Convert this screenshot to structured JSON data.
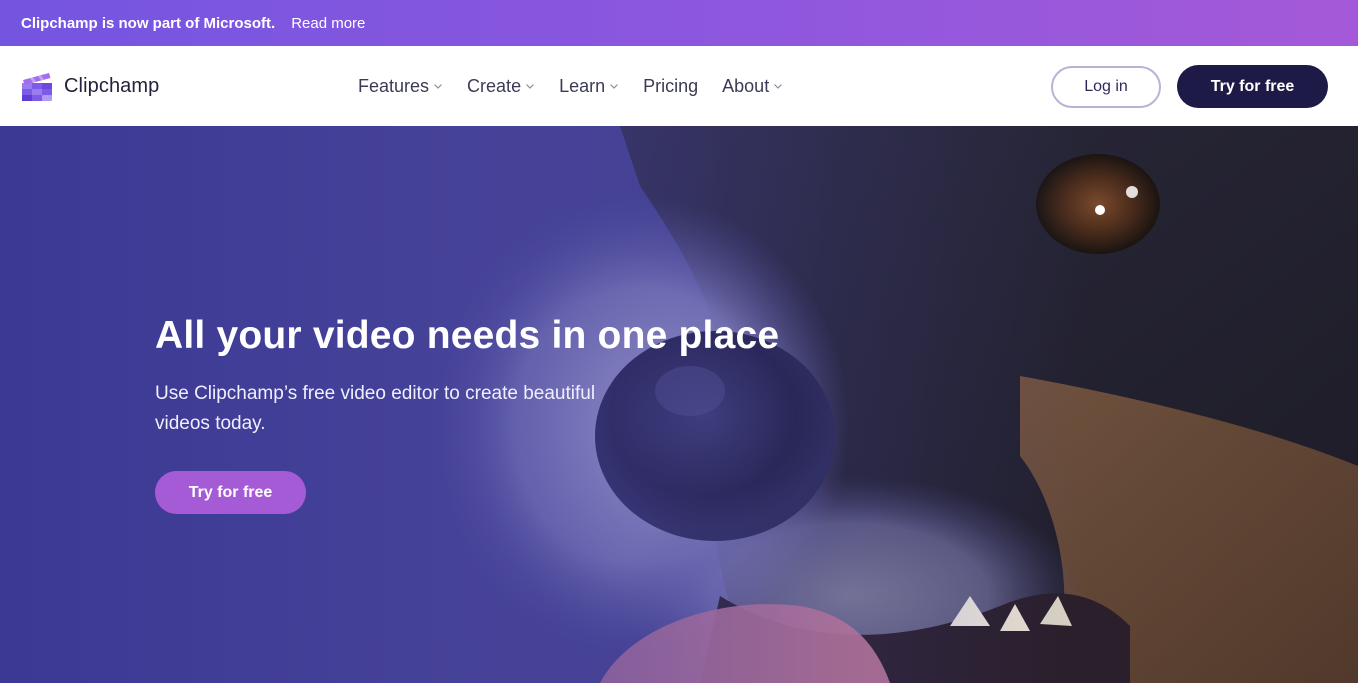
{
  "announcement": {
    "message": "Clipchamp is now part of Microsoft.",
    "link_label": "Read more"
  },
  "header": {
    "logo_text": "Clipchamp",
    "nav": [
      {
        "label": "Features",
        "has_dropdown": true
      },
      {
        "label": "Create",
        "has_dropdown": true
      },
      {
        "label": "Learn",
        "has_dropdown": true
      },
      {
        "label": "Pricing",
        "has_dropdown": false
      },
      {
        "label": "About",
        "has_dropdown": true
      }
    ],
    "login_label": "Log in",
    "try_label": "Try for free"
  },
  "hero": {
    "title": "All your video needs in one place",
    "subtitle": "Use Clipchamp’s free video editor to create beautiful videos today.",
    "cta_label": "Try for free",
    "background_icon": "dog-closeup-image"
  },
  "colors": {
    "announce_gradient_start": "#7455e0",
    "announce_gradient_end": "#a559d8",
    "nav_text": "#3b3b55",
    "primary_dark": "#1d1a48",
    "hero_cta": "#a55bd6",
    "hero_overlay": "#3a3796"
  }
}
